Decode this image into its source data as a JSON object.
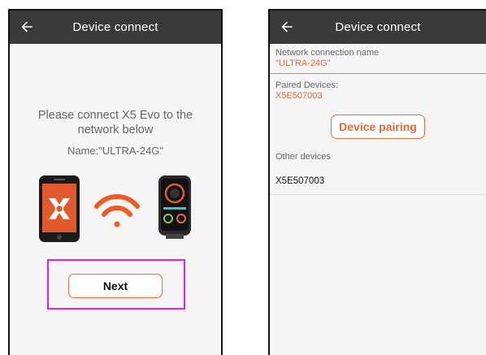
{
  "left_screen": {
    "title": "Device connect",
    "instruction": "Please connect X5 Evo to the network below",
    "network_name_line": "Name:\"ULTRA-24G\"",
    "next_label": "Next",
    "colors": {
      "accent": "#e0703f",
      "phone_body": "#e05a2c",
      "highlight": "#e81be8",
      "appbar": "#3a3a3a"
    },
    "icons": [
      "back-arrow-icon",
      "phone-app-icon",
      "wifi-icon",
      "bike-computer-icon"
    ]
  },
  "right_screen": {
    "title": "Device connect",
    "network_label": "Network connection name",
    "network_value": "\"ULTRA-24G\"",
    "paired_label": "Paired Devices:",
    "paired_value": "X5E507003",
    "pair_button_label": "Device pairing",
    "other_devices_label": "Other devices",
    "other_devices": [
      "X5E507003"
    ]
  }
}
